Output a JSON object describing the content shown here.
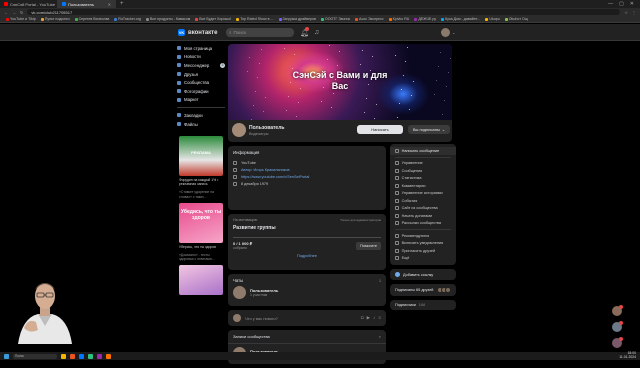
{
  "browser": {
    "tabs": [
      {
        "label": "СэнСэй Portal - YouTube",
        "color": "#ff0000",
        "active": false
      },
      {
        "label": "Пользователь",
        "color": "#0077ff",
        "active": true
      }
    ],
    "url": "vk.com/club211705517",
    "bookmarks": [
      {
        "label": "YouTube и Tiktp",
        "color": "#ff0000"
      },
      {
        "label": "Пульт подключ",
        "color": "#e6a23c"
      },
      {
        "label": "Сергеев Вячеслав",
        "color": "#4caf50"
      },
      {
        "label": "RuTracker.org",
        "color": "#3a7bd5"
      },
      {
        "label": "Все продукты - Кавасом",
        "color": "#888888"
      },
      {
        "label": "Все Будет Хорошо!",
        "color": "#e64646"
      },
      {
        "label": "Top Rated Show в ...",
        "color": "#f4b400"
      },
      {
        "label": "Загрузка драйверов",
        "color": "#7b61ff"
      },
      {
        "label": "ОООТГ Звонок",
        "color": "#2ec27e"
      },
      {
        "label": "Асос Экспресс",
        "color": "#e95420"
      },
      {
        "label": "Kyivko RU",
        "color": "#ff6f00"
      },
      {
        "label": "ДЕЖЧЕ.ру",
        "color": "#9c27b0"
      },
      {
        "label": "Кука Дом - давайте...",
        "color": "#03a9f4"
      },
      {
        "label": "Ukupu",
        "color": "#ffb300"
      },
      {
        "label": "Оkuhoт Ощ",
        "color": "#8bc34a"
      }
    ]
  },
  "vk": {
    "logo_text": "вконтакте",
    "search_placeholder": "Поиск",
    "nav": [
      {
        "label": "Моя страница"
      },
      {
        "label": "Новости"
      },
      {
        "label": "Мессенджер",
        "badge": "3"
      },
      {
        "label": "Друзья"
      },
      {
        "label": "Сообщества"
      },
      {
        "label": "Фотографии"
      },
      {
        "label": "Маркет"
      }
    ],
    "nav2": [
      {
        "label": "Закладки"
      },
      {
        "label": "Файлы"
      }
    ],
    "ads": [
      {
        "caption": "Форудин на каждый 1% • рекламная запись",
        "sub": "«Ставьте ударение на словах» с таких...",
        "img_text": "РЕКЛАМА"
      },
      {
        "caption": "Уберись, что ты здоров",
        "sub": "«Доказано» - тесты здоровья с ответами...",
        "img_text": "Убедись, что ты здоров"
      },
      {
        "caption": "Рак, обнаруженный на ранней стадии, излечим в 90% случаев",
        "sub": "Пройдите обследование ...",
        "img_text": ""
      }
    ]
  },
  "group": {
    "cover_title": "СэнСэй с Вами и для Вас",
    "name": "Пользователь",
    "subtitle": "Видеоигры",
    "btn_message": "Написать",
    "btn_subscribed": "Вы подписаны",
    "info_title": "Информация",
    "info_rows": [
      {
        "text": "YouTube",
        "link": false
      },
      {
        "text": "Автор: Игорь Красильников",
        "link": true
      },
      {
        "text": "https://www.youtube.com/c/SenSeiPortal",
        "link": true
      },
      {
        "text": "8 декабря 1979",
        "link": false
      }
    ],
    "goal_header_left": "На мотивацию",
    "goal_header_right": "Только для администраторов",
    "goal_title": "Развитие группы",
    "goal_amount": "0 / 1 000 ₽",
    "goal_sub": "собрано",
    "goal_button": "Помогите",
    "more_link": "Подробнее",
    "chats_title": "Чаты",
    "chats_count": "1",
    "chat_name": "Пользователь",
    "chat_sub": "1 участник",
    "post_placeholder": "Что у вас нового?",
    "tab_posts": "Записи сообщества",
    "post_author": "Пользователь",
    "post_time": "1 час в 10:00"
  },
  "menu": {
    "items": [
      {
        "label": "Написать сообщение",
        "active": true
      },
      {
        "label": "Управление",
        "sep": true
      },
      {
        "label": "Сообщения"
      },
      {
        "label": "Статистика"
      },
      {
        "label": "Комментарии"
      },
      {
        "label": "Управление историями"
      },
      {
        "label": "События"
      },
      {
        "label": "Сайт из сообщества"
      },
      {
        "label": "Начать донатами"
      },
      {
        "label": "Рассылки сообщества"
      },
      {
        "label": "Рекомендуются",
        "sep": true
      },
      {
        "label": "Включить уведомления"
      },
      {
        "label": "Пригласить друзей"
      },
      {
        "label": "Ещё"
      }
    ],
    "add_link": "Добавить ссылку",
    "friends_subscribed": "Подписаны 65 друзей",
    "subscribers": "Подписчики",
    "subscribers_count": "144"
  },
  "taskbar": {
    "search": "Поиск",
    "time": "18:00",
    "date": "11.01.2024"
  }
}
